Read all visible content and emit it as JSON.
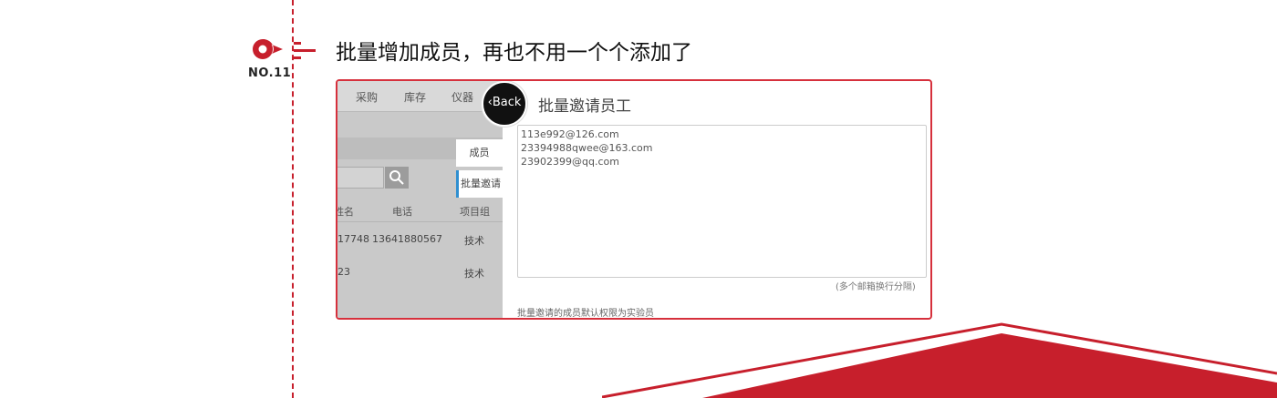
{
  "section": {
    "number_label": "NO.11",
    "headline": "批量增加成员，再也不用一个个添加了"
  },
  "app": {
    "nav": [
      "采购",
      "库存",
      "仪器"
    ],
    "side_tabs": {
      "members": "成员",
      "batch_invite": "批量邀请"
    },
    "table": {
      "headers": [
        "姓名",
        "电话",
        "项目组"
      ],
      "rows": [
        {
          "name": "17748",
          "phone": "13641880567",
          "group": "技术"
        },
        {
          "name": "23",
          "phone": "",
          "group": "技术"
        }
      ]
    }
  },
  "back_button": "Back",
  "panel": {
    "title": "批量邀请员工",
    "emails": [
      "113e992@126.com",
      "23394988qwee@163.com",
      "23902399@qq.com"
    ],
    "hint": "(多个邮箱换行分隔)",
    "note": "批量邀请的成员默认权限为实验员"
  },
  "colors": {
    "accent_red": "#c71f2c",
    "tab_blue": "#2f8fd0",
    "panel_gray": "#c9c9c9"
  }
}
